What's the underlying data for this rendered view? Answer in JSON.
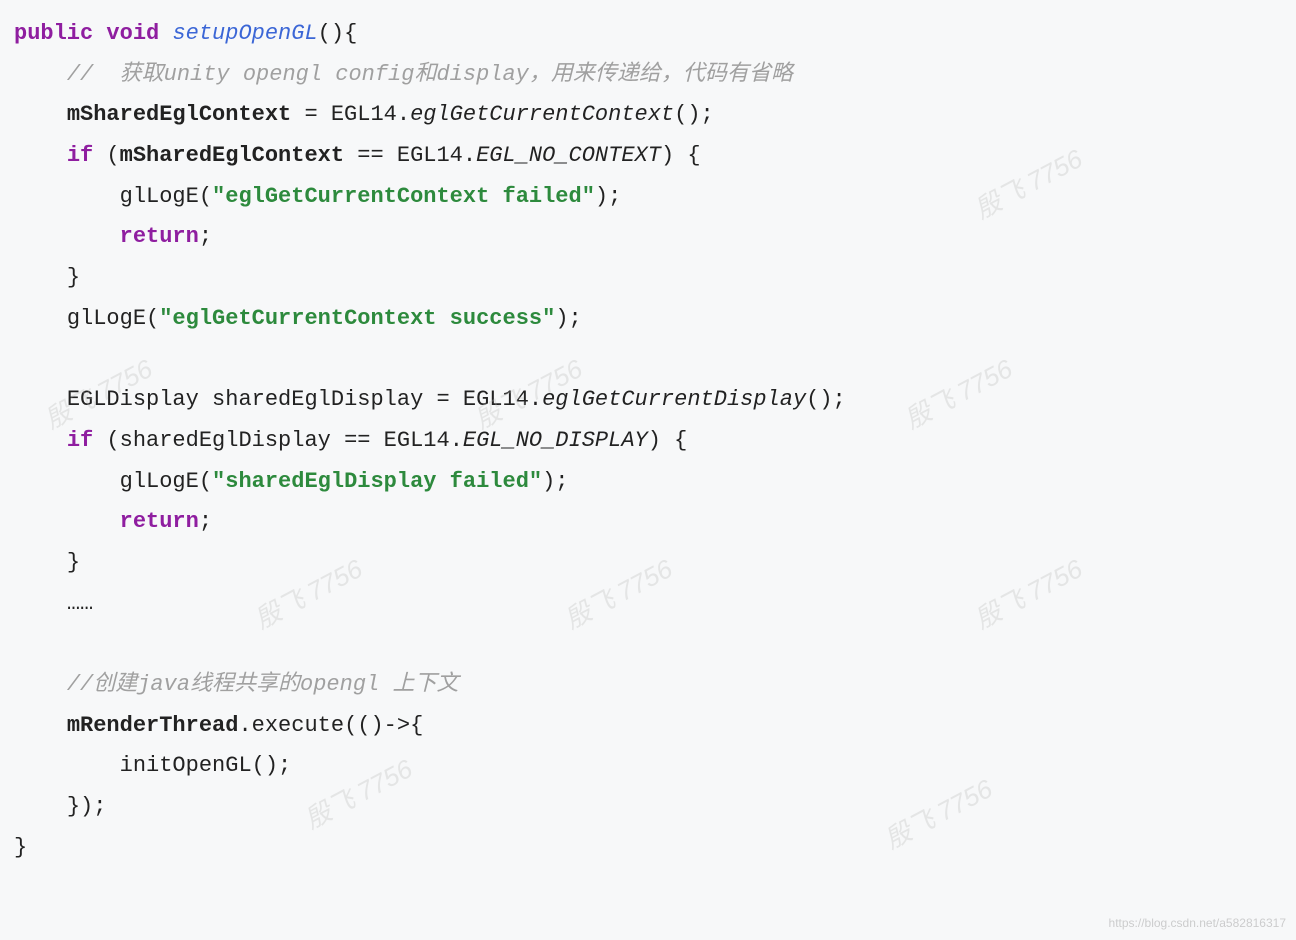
{
  "code": {
    "kw_public": "public",
    "kw_void": "void",
    "fn_name": "setupOpenGL",
    "comment1": "//  获取unity opengl config和display，用来传递给，代码有省略",
    "var_ctx": "mSharedEglContext",
    "cls_egl14": "EGL14",
    "m_getctx": "eglGetCurrentContext",
    "kw_if": "if",
    "c_no_ctx": "EGL_NO_CONTEXT",
    "fn_loge": "glLogE",
    "str_ctx_fail": "\"eglGetCurrentContext failed\"",
    "kw_return": "return",
    "str_ctx_ok": "\"eglGetCurrentContext success\"",
    "type_egldisp": "EGLDisplay",
    "var_disp": "sharedEglDisplay",
    "m_getdisp": "eglGetCurrentDisplay",
    "c_no_disp": "EGL_NO_DISPLAY",
    "str_disp_fail": "\"sharedEglDisplay failed\"",
    "ellipsis": "……",
    "comment2": "//创建java线程共享的opengl 上下文",
    "var_thread": "mRenderThread",
    "m_exec": "execute",
    "fn_init": "initOpenGL"
  },
  "watermark": {
    "text": "殷飞 7756",
    "footer": "https://blog.csdn.net/a582816317"
  }
}
